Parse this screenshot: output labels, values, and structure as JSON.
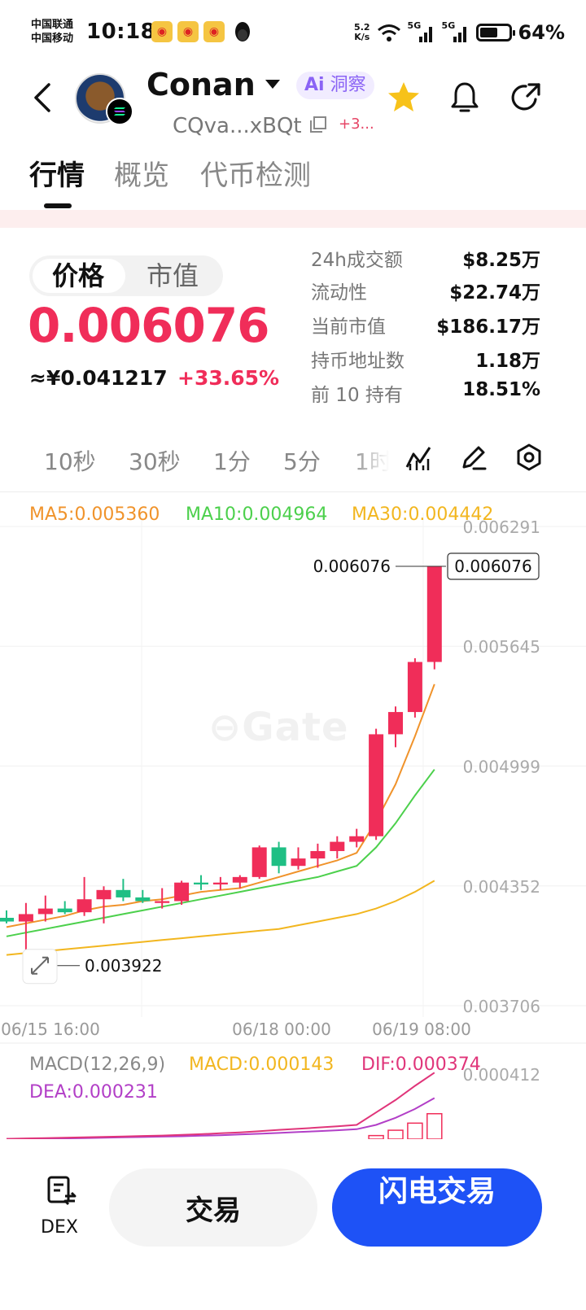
{
  "status_bar": {
    "carrier_1": "中国联通",
    "carrier_2": "中国移动",
    "time": "10:18",
    "net_speed_value": "5.2",
    "net_speed_unit": "K/s",
    "signal_1": "5G",
    "signal_2": "5G",
    "battery": "64%",
    "battery_level": 0.64
  },
  "header": {
    "token_name": "Conan",
    "ai_badge_prefix": "Ai",
    "ai_badge_label": "洞察",
    "address": "CQva...xBQt",
    "address_extra": "+3..."
  },
  "tabs": [
    {
      "label": "行情"
    },
    {
      "label": "概览"
    },
    {
      "label": "代币检测"
    }
  ],
  "price_panel": {
    "toggle_price": "价格",
    "toggle_mcap": "市值",
    "price": "0.006076",
    "price_cny": "≈¥0.041217",
    "change": "+33.65%"
  },
  "stats": [
    {
      "label": "24h成交额",
      "value": "$8.25万"
    },
    {
      "label": "流动性",
      "value": "$22.74万"
    },
    {
      "label": "当前市值",
      "value": "$186.17万"
    },
    {
      "label": "持币地址数",
      "value": "1.18万"
    },
    {
      "label": "前 10 持有",
      "value": "18.51%"
    }
  ],
  "intervals": [
    {
      "label": "10秒"
    },
    {
      "label": "30秒"
    },
    {
      "label": "1分"
    },
    {
      "label": "5分"
    },
    {
      "label": "1时"
    }
  ],
  "ma_legend": {
    "ma5": "MA5:0.005360",
    "ma10": "MA10:0.004964",
    "ma30": "MA30:0.004442"
  },
  "colors": {
    "up": "#f02d59",
    "down": "#1fbf84",
    "ma5": "#f0932b",
    "ma10": "#4cd04c",
    "ma30": "#f2b61f",
    "dif": "#e0357a",
    "dea": "#b23fc7",
    "accent": "#1e52f6"
  },
  "chart_data": {
    "type": "candlestick",
    "y_ticks": [
      "0.006291",
      "0.005645",
      "0.004999",
      "0.004352",
      "0.003706"
    ],
    "x_ticks": [
      "06/15 16:00",
      "06/18 00:00",
      "06/19 08:00"
    ],
    "ylim": [
      0.003706,
      0.006291
    ],
    "last_price_label": "0.006076",
    "last_price_tag": "0.006076",
    "low_label": "0.003922",
    "candles": [
      {
        "o": 0.00418,
        "h": 0.00422,
        "l": 0.00415,
        "c": 0.00416
      },
      {
        "o": 0.00416,
        "h": 0.00426,
        "l": 0.003922,
        "c": 0.0042
      },
      {
        "o": 0.0042,
        "h": 0.0043,
        "l": 0.00416,
        "c": 0.00423
      },
      {
        "o": 0.00423,
        "h": 0.00427,
        "l": 0.0042,
        "c": 0.00421
      },
      {
        "o": 0.00421,
        "h": 0.0044,
        "l": 0.00419,
        "c": 0.00428
      },
      {
        "o": 0.00428,
        "h": 0.00435,
        "l": 0.00415,
        "c": 0.00433
      },
      {
        "o": 0.00433,
        "h": 0.00439,
        "l": 0.00427,
        "c": 0.00429
      },
      {
        "o": 0.00429,
        "h": 0.00433,
        "l": 0.00426,
        "c": 0.00427
      },
      {
        "o": 0.00426,
        "h": 0.00434,
        "l": 0.00423,
        "c": 0.00427
      },
      {
        "o": 0.00427,
        "h": 0.00438,
        "l": 0.00425,
        "c": 0.00437
      },
      {
        "o": 0.00437,
        "h": 0.00441,
        "l": 0.00433,
        "c": 0.00436
      },
      {
        "o": 0.00436,
        "h": 0.0044,
        "l": 0.00433,
        "c": 0.00437
      },
      {
        "o": 0.00437,
        "h": 0.00441,
        "l": 0.00434,
        "c": 0.0044
      },
      {
        "o": 0.0044,
        "h": 0.00457,
        "l": 0.00439,
        "c": 0.00456
      },
      {
        "o": 0.00456,
        "h": 0.00459,
        "l": 0.00442,
        "c": 0.00446
      },
      {
        "o": 0.00446,
        "h": 0.00456,
        "l": 0.00444,
        "c": 0.0045
      },
      {
        "o": 0.0045,
        "h": 0.00458,
        "l": 0.00445,
        "c": 0.00454
      },
      {
        "o": 0.00454,
        "h": 0.00462,
        "l": 0.0045,
        "c": 0.00459
      },
      {
        "o": 0.00459,
        "h": 0.00466,
        "l": 0.00456,
        "c": 0.00462
      },
      {
        "o": 0.00462,
        "h": 0.0052,
        "l": 0.0046,
        "c": 0.00517
      },
      {
        "o": 0.00517,
        "h": 0.00532,
        "l": 0.0051,
        "c": 0.00529
      },
      {
        "o": 0.00529,
        "h": 0.00558,
        "l": 0.00526,
        "c": 0.00556
      },
      {
        "o": 0.00556,
        "h": 0.006076,
        "l": 0.00552,
        "c": 0.006076
      }
    ],
    "ma5": [
      0.00413,
      0.00415,
      0.00417,
      0.00419,
      0.00422,
      0.00424,
      0.00425,
      0.00427,
      0.00428,
      0.0043,
      0.00432,
      0.00433,
      0.00434,
      0.00437,
      0.0044,
      0.00443,
      0.00446,
      0.00449,
      0.00453,
      0.0047,
      0.0049,
      0.00516,
      0.00544
    ],
    "ma10": [
      0.00408,
      0.0041,
      0.00412,
      0.00414,
      0.00416,
      0.00418,
      0.0042,
      0.00422,
      0.00424,
      0.00426,
      0.00428,
      0.0043,
      0.00432,
      0.00434,
      0.00436,
      0.00438,
      0.0044,
      0.00443,
      0.00446,
      0.00456,
      0.00469,
      0.00484,
      0.00498
    ],
    "ma30": [
      0.00398,
      0.00399,
      0.004,
      0.00401,
      0.00402,
      0.00403,
      0.00404,
      0.00405,
      0.00406,
      0.00407,
      0.00408,
      0.00409,
      0.0041,
      0.00411,
      0.00412,
      0.00414,
      0.00416,
      0.00418,
      0.0042,
      0.00423,
      0.00427,
      0.00432,
      0.00438
    ]
  },
  "macd": {
    "title": "MACD(12,26,9)",
    "macd_label": "MACD:0.000143",
    "dif_label": "DIF:0.000374",
    "dea_label": "DEA:0.000231",
    "y_tick": "0.000412",
    "ylim": [
      0.0,
      0.000412
    ],
    "dif": [
      2e-06,
      4e-06,
      6e-06,
      8e-06,
      1e-05,
      1.3e-05,
      1.5e-05,
      1.8e-05,
      2e-05,
      2.4e-05,
      2.8e-05,
      3.3e-05,
      3.8e-05,
      4.5e-05,
      5.2e-05,
      5.8e-05,
      6.5e-05,
      7.2e-05,
      8e-05,
      0.00015,
      0.00022,
      0.0003,
      0.000374
    ],
    "dea": [
      1e-06,
      2e-06,
      3e-06,
      4e-06,
      6e-06,
      8e-06,
      1e-05,
      1.2e-05,
      1.4e-05,
      1.6e-05,
      1.9e-05,
      2.2e-05,
      2.6e-05,
      3e-05,
      3.5e-05,
      4e-05,
      4.5e-05,
      5e-05,
      5.6e-05,
      8e-05,
      0.00012,
      0.00017,
      0.000231
    ],
    "hist": [
      0,
      0,
      0,
      0,
      0,
      0,
      0,
      0,
      0,
      0,
      0,
      0,
      0,
      0,
      0,
      0,
      0,
      0,
      0,
      2e-05,
      5e-05,
      9e-05,
      0.000143
    ]
  },
  "bottom": {
    "dex_label": "DEX",
    "trade_label": "交易",
    "flash_label": "闪电交易"
  }
}
